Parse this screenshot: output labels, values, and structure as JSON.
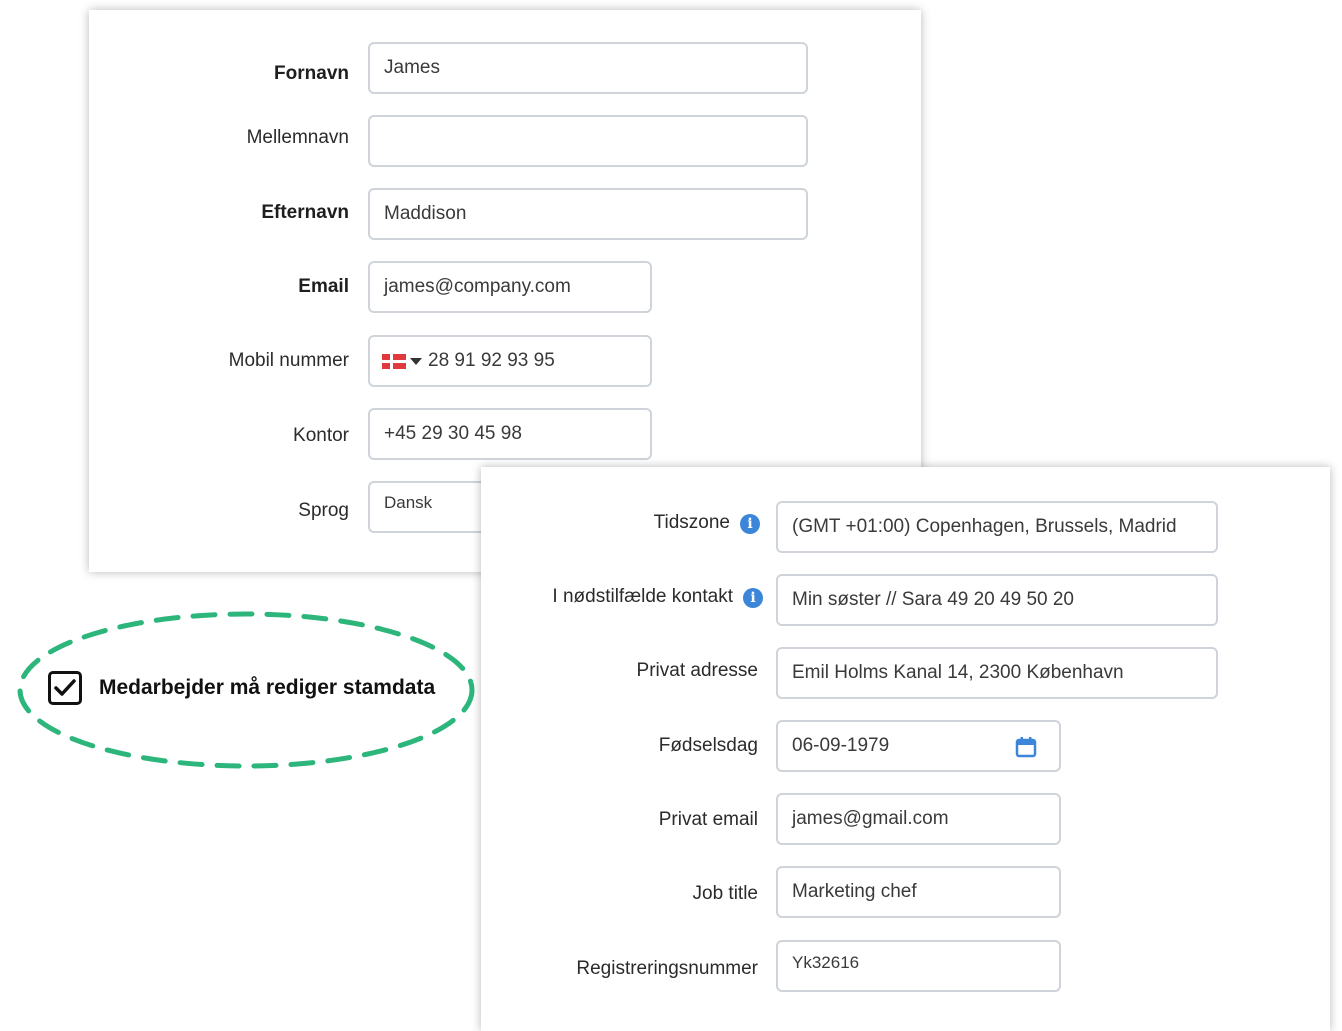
{
  "form1": {
    "fields": [
      {
        "label": "Fornavn",
        "value": "James"
      },
      {
        "label": "Mellemnavn",
        "value": ""
      },
      {
        "label": "Efternavn",
        "value": "Maddison"
      },
      {
        "label": "Email",
        "value": "james@company.com"
      },
      {
        "label": "Mobil nummer",
        "value": "28 91 92 93 95"
      },
      {
        "label": "Kontor",
        "value": "+45 29 30 45 98"
      },
      {
        "label": "Sprog",
        "value": "Dansk"
      }
    ]
  },
  "checkbox": {
    "label": "Medarbejder må rediger stamdata",
    "checked": true,
    "highlight_color": "#2db67c"
  },
  "form2": {
    "fields": [
      {
        "label": "Tidszone",
        "value": "(GMT +01:00) Copenhagen, Brussels, Madrid"
      },
      {
        "label": "I nødstilfælde kontakt",
        "value": "Min søster // Sara 49 20 49 50 20"
      },
      {
        "label": "Privat adresse",
        "value": "Emil Holms Kanal 14, 2300 København"
      },
      {
        "label": "Fødselsdag",
        "value": "06-09-1979"
      },
      {
        "label": "Privat email",
        "value": "james@gmail.com"
      },
      {
        "label": "Job title",
        "value": "Marketing chef"
      },
      {
        "label": "Registreringsnummer",
        "value": "Yk32616"
      }
    ]
  },
  "colors": {
    "info_icon": "#3b86d8",
    "calendar_icon": "#3b86d8",
    "flag_red": "#e03a3e",
    "input_border": "#cfd4da"
  }
}
